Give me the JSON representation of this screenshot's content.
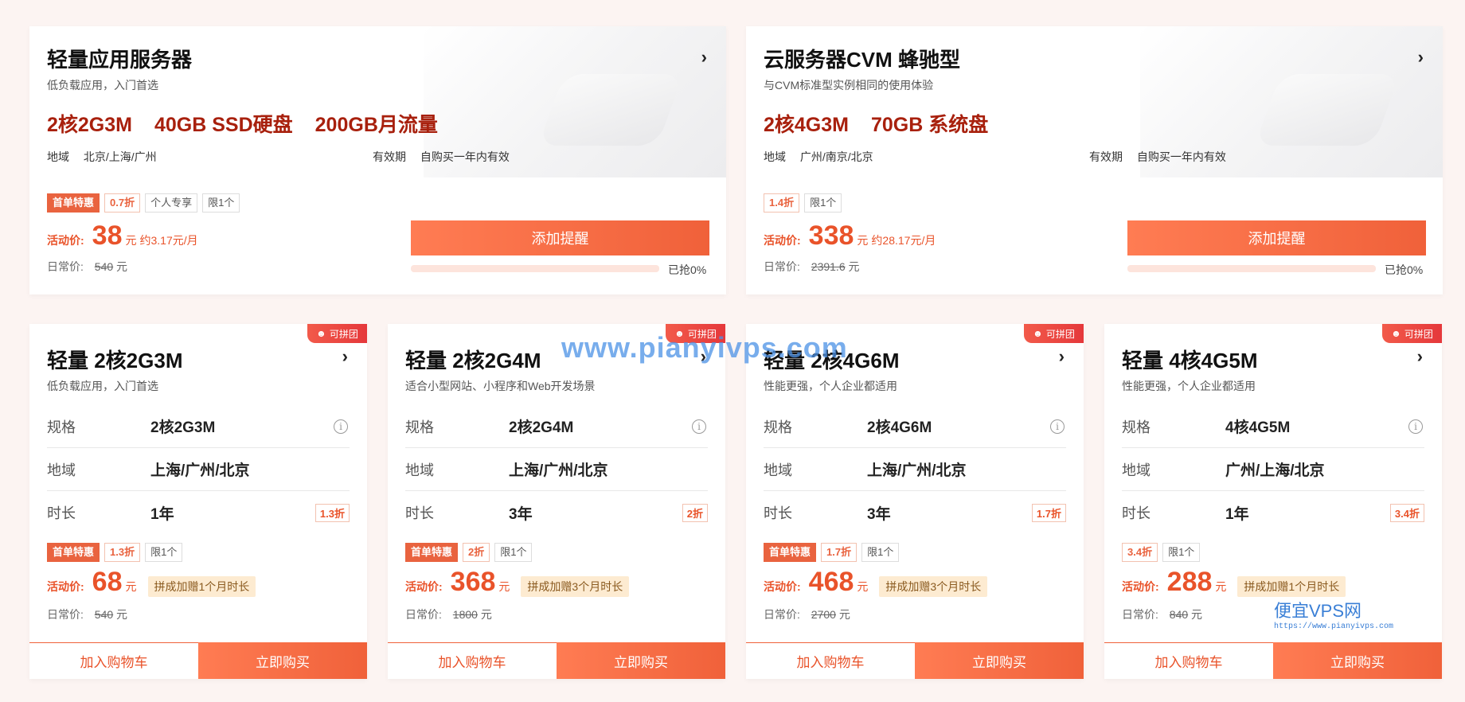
{
  "top_cards": [
    {
      "title": "轻量应用服务器",
      "subtitle": "低负载应用，入门首选",
      "specs": [
        "2核2G3M",
        "40GB SSD硬盘",
        "200GB月流量"
      ],
      "region_label": "地域",
      "region": "北京/上海/广州",
      "validity_label": "有效期",
      "validity": "自购买一年内有效",
      "tags": [
        "首单特惠",
        "0.7折",
        "个人专享",
        "限1个"
      ],
      "price_label": "活动价:",
      "price": "38",
      "unit": "元",
      "per_month": "约3.17元/月",
      "normal_label": "日常价:",
      "normal_price": "540",
      "normal_unit": "元",
      "button": "添加提醒",
      "progress": 0,
      "progress_text": "0%",
      "sold": "已抢0%"
    },
    {
      "title": "云服务器CVM 蜂驰型",
      "subtitle": "与CVM标准型实例相同的使用体验",
      "specs": [
        "2核4G3M",
        "70GB 系统盘"
      ],
      "region_label": "地域",
      "region": "广州/南京/北京",
      "validity_label": "有效期",
      "validity": "自购买一年内有效",
      "tags": [
        "1.4折",
        "限1个"
      ],
      "price_label": "活动价:",
      "price": "338",
      "unit": "元",
      "per_month": "约28.17元/月",
      "normal_label": "日常价:",
      "normal_price": "2391.6",
      "normal_unit": "元",
      "button": "添加提醒",
      "progress": 0,
      "progress_text": "0%",
      "sold": "已抢0%"
    }
  ],
  "bottom_cards": [
    {
      "badge": "可拼团",
      "title": "轻量 2核2G3M",
      "subtitle": "低负载应用，入门首选",
      "rows": [
        {
          "k": "规格",
          "v": "2核2G3M"
        },
        {
          "k": "地域",
          "v": "上海/广州/北京"
        },
        {
          "k": "时长",
          "v": "1年",
          "discount": "1.3折"
        }
      ],
      "tags": [
        "首单特惠",
        "1.3折",
        "限1个"
      ],
      "price_label": "活动价:",
      "price": "68",
      "unit": "元",
      "promo": "拼成加赠1个月时长",
      "normal_label": "日常价:",
      "normal_price": "540",
      "normal_unit": "元",
      "cart": "加入购物车",
      "buy": "立即购买"
    },
    {
      "badge": "可拼团",
      "title": "轻量 2核2G4M",
      "subtitle": "适合小型网站、小程序和Web开发场景",
      "rows": [
        {
          "k": "规格",
          "v": "2核2G4M"
        },
        {
          "k": "地域",
          "v": "上海/广州/北京"
        },
        {
          "k": "时长",
          "v": "3年",
          "discount": "2折"
        }
      ],
      "tags": [
        "首单特惠",
        "2折",
        "限1个"
      ],
      "price_label": "活动价:",
      "price": "368",
      "unit": "元",
      "promo": "拼成加赠3个月时长",
      "normal_label": "日常价:",
      "normal_price": "1800",
      "normal_unit": "元",
      "cart": "加入购物车",
      "buy": "立即购买"
    },
    {
      "badge": "可拼团",
      "title": "轻量 2核4G6M",
      "subtitle": "性能更强，个人企业都适用",
      "rows": [
        {
          "k": "规格",
          "v": "2核4G6M"
        },
        {
          "k": "地域",
          "v": "上海/广州/北京"
        },
        {
          "k": "时长",
          "v": "3年",
          "discount": "1.7折"
        }
      ],
      "tags": [
        "首单特惠",
        "1.7折",
        "限1个"
      ],
      "price_label": "活动价:",
      "price": "468",
      "unit": "元",
      "promo": "拼成加赠3个月时长",
      "normal_label": "日常价:",
      "normal_price": "2700",
      "normal_unit": "元",
      "cart": "加入购物车",
      "buy": "立即购买"
    },
    {
      "badge": "可拼团",
      "title": "轻量 4核4G5M",
      "subtitle": "性能更强，个人企业都适用",
      "rows": [
        {
          "k": "规格",
          "v": "4核4G5M"
        },
        {
          "k": "地域",
          "v": "广州/上海/北京"
        },
        {
          "k": "时长",
          "v": "1年",
          "discount": "3.4折"
        }
      ],
      "tags": [
        "3.4折",
        "限1个"
      ],
      "price_label": "活动价:",
      "price": "288",
      "unit": "元",
      "promo": "拼成加赠1个月时长",
      "normal_label": "日常价:",
      "normal_price": "840",
      "normal_unit": "元",
      "cart": "加入购物车",
      "buy": "立即购买"
    }
  ],
  "watermark": "www.pianyivps.com",
  "logo": {
    "text": "便宜VPS网",
    "url": "https://www.pianyivps.com"
  },
  "colors": {
    "accent": "#f0613a",
    "price": "#e9532a",
    "spec": "#a8200d"
  }
}
